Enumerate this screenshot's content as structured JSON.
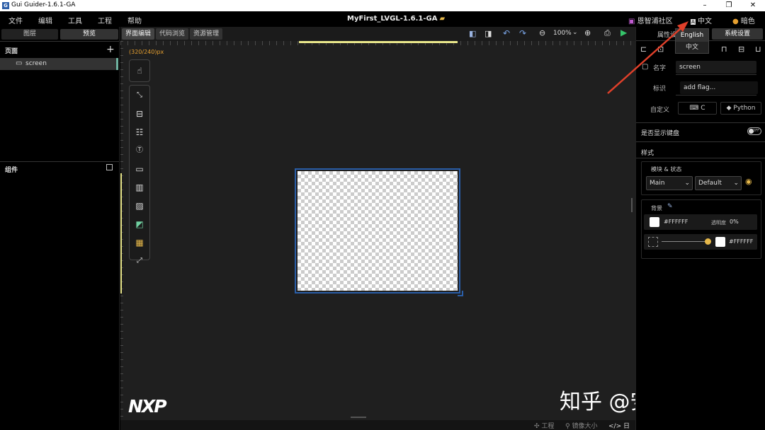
{
  "titlebar": {
    "app_icon": "G",
    "title": "Gui Guider-1.6.1-GA",
    "minimize": "–",
    "restore": "❐",
    "close": "✕"
  },
  "menu": {
    "items": [
      "文件",
      "编辑",
      "工具",
      "工程",
      "帮助"
    ]
  },
  "project": {
    "title": "MyFirst_LVGL-1.6.1-GA"
  },
  "top_right": {
    "community": "恩智浦社区",
    "language": "中文",
    "theme": "暗色"
  },
  "lang_dropdown": {
    "options": [
      "English",
      "中文"
    ]
  },
  "left_panel": {
    "tabs": [
      "图层",
      "预览"
    ],
    "pages_title": "页面",
    "add_icon": "+",
    "screen_item": "screen",
    "widgets_title": "组件"
  },
  "canvas_tabs": [
    "界面编辑",
    "代码浏览",
    "资源管理"
  ],
  "toolbar": {
    "zoom": "100%"
  },
  "canvas": {
    "resolution": "(320/240)px"
  },
  "logo": "NXP",
  "statusbar": {
    "project": "工程",
    "image_size": "镜像大小",
    "log": "日志"
  },
  "right_panel": {
    "tabs": [
      "属性设置",
      "系统设置"
    ],
    "name_label": "名字",
    "name_value": "screen",
    "flag_label": "标识",
    "flag_placeholder": "add flag...",
    "custom_label": "自定义",
    "custom_c": "C",
    "custom_python": "Python",
    "keyboard_label": "是否显示键盘",
    "toggle_text": "OFF",
    "style_label": "样式",
    "part_state_label": "模块 & 状态",
    "part_value": "Main",
    "state_value": "Default",
    "bg_label": "背景",
    "bg_color": "#FFFFFF",
    "opacity_label": "透明度",
    "opacity_value": "0%",
    "gradient_color": "#FFFFFF"
  },
  "watermark": "知乎 @安信可科技",
  "colors": {
    "accent": "#6fb2a0",
    "selection": "#2a5ea8",
    "folder": "#e6b84a",
    "arrow": "#e0402a"
  }
}
